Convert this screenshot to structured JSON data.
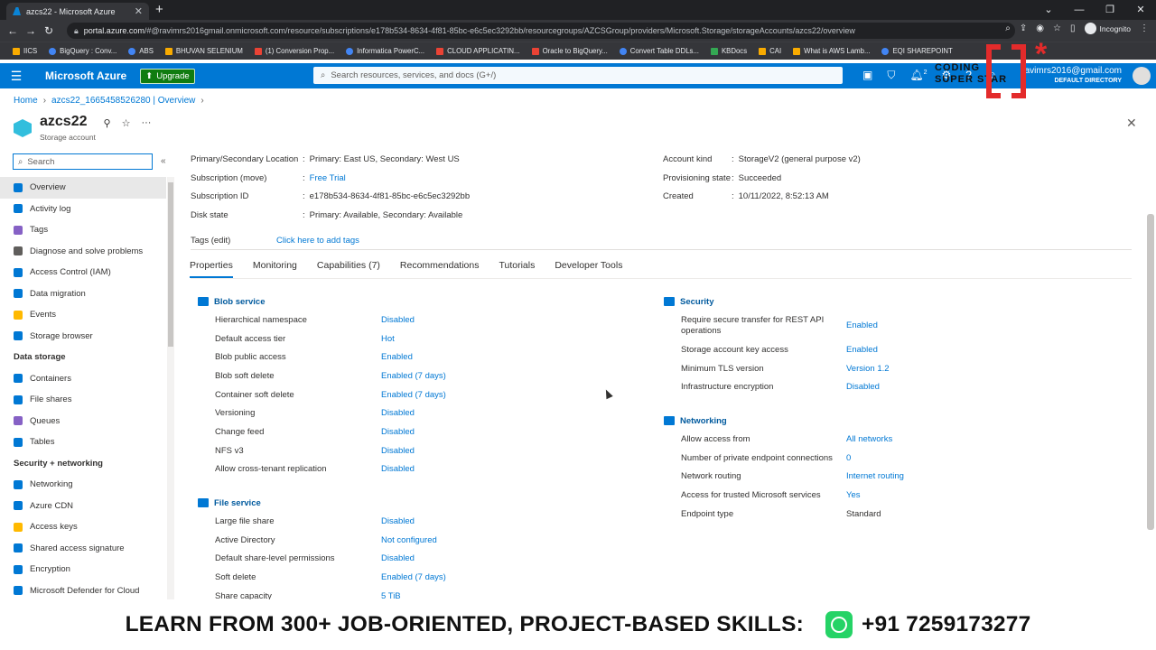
{
  "browser": {
    "tab_title": "azcs22 - Microsoft Azure",
    "url_host": "portal.azure.com",
    "url_rest": "/#@ravimrs2016gmail.onmicrosoft.com/resource/subscriptions/e178b534-8634-4f81-85bc-e6c5ec3292bb/resourcegroups/AZCSGroup/providers/Microsoft.Storage/storageAccounts/azcs22/overview",
    "incognito_label": "Incognito",
    "bookmarks": [
      "IICS",
      "BigQuery : Conv...",
      "ABS",
      "BHUVAN SELENIUM",
      "(1) Conversion Prop...",
      "Informatica PowerC...",
      "CLOUD APPLICATIN...",
      "Oracle to BigQuery...",
      "Convert Table DDLs...",
      "KBDocs",
      "CAI",
      "What is AWS Lamb...",
      "EQI SHAREPOINT"
    ]
  },
  "portal": {
    "brand": "Microsoft Azure",
    "upgrade_label": "Upgrade",
    "search_placeholder": "Search resources, services, and docs (G+/)",
    "notification_count": "2",
    "user_email": "ravimrs2016@gmail.com",
    "user_directory": "DEFAULT DIRECTORY"
  },
  "watermark": {
    "line1": "CODING",
    "line2": "SUPER STAR"
  },
  "breadcrumb": {
    "home": "Home",
    "item": "azcs22_1665458526280 | Overview"
  },
  "resource": {
    "name": "azcs22",
    "type": "Storage account"
  },
  "sidebar": {
    "search_placeholder": "Search",
    "items": [
      {
        "label": "Overview",
        "color": "#0078d4"
      },
      {
        "label": "Activity log",
        "color": "#0078d4"
      },
      {
        "label": "Tags",
        "color": "#8661c5"
      },
      {
        "label": "Diagnose and solve problems",
        "color": "#605e5c"
      },
      {
        "label": "Access Control (IAM)",
        "color": "#0078d4"
      },
      {
        "label": "Data migration",
        "color": "#0078d4"
      },
      {
        "label": "Events",
        "color": "#ffb900"
      },
      {
        "label": "Storage browser",
        "color": "#0078d4"
      }
    ],
    "data_storage_heading": "Data storage",
    "data_storage_items": [
      {
        "label": "Containers",
        "color": "#0078d4"
      },
      {
        "label": "File shares",
        "color": "#0078d4"
      },
      {
        "label": "Queues",
        "color": "#8661c5"
      },
      {
        "label": "Tables",
        "color": "#0078d4"
      }
    ],
    "security_heading": "Security + networking",
    "security_items": [
      {
        "label": "Networking",
        "color": "#0078d4"
      },
      {
        "label": "Azure CDN",
        "color": "#0078d4"
      },
      {
        "label": "Access keys",
        "color": "#ffb900"
      },
      {
        "label": "Shared access signature",
        "color": "#0078d4"
      },
      {
        "label": "Encryption",
        "color": "#0078d4"
      },
      {
        "label": "Microsoft Defender for Cloud",
        "color": "#0078d4"
      }
    ]
  },
  "essentials": {
    "left": [
      {
        "label": "Primary/Secondary Location",
        "value": "Primary: East US, Secondary: West US"
      },
      {
        "label": "Subscription (move)",
        "value": "Free Trial"
      },
      {
        "label": "Subscription ID",
        "value": "e178b534-8634-4f81-85bc-e6c5ec3292bb"
      },
      {
        "label": "Disk state",
        "value": "Primary: Available, Secondary: Available"
      }
    ],
    "right": [
      {
        "label": "Account kind",
        "value": "StorageV2 (general purpose v2)"
      },
      {
        "label": "Provisioning state",
        "value": "Succeeded"
      },
      {
        "label": "Created",
        "value": "10/11/2022, 8:52:13 AM"
      }
    ],
    "tags_label": "Tags (edit)",
    "tags_value": "Click here to add tags"
  },
  "tabs": [
    "Properties",
    "Monitoring",
    "Capabilities (7)",
    "Recommendations",
    "Tutorials",
    "Developer Tools"
  ],
  "blob_service": {
    "title": "Blob service",
    "props": [
      {
        "k": "Hierarchical namespace",
        "v": "Disabled"
      },
      {
        "k": "Default access tier",
        "v": "Hot"
      },
      {
        "k": "Blob public access",
        "v": "Enabled"
      },
      {
        "k": "Blob soft delete",
        "v": "Enabled (7 days)"
      },
      {
        "k": "Container soft delete",
        "v": "Enabled (7 days)"
      },
      {
        "k": "Versioning",
        "v": "Disabled"
      },
      {
        "k": "Change feed",
        "v": "Disabled"
      },
      {
        "k": "NFS v3",
        "v": "Disabled"
      },
      {
        "k": "Allow cross-tenant replication",
        "v": "Disabled"
      }
    ]
  },
  "file_service": {
    "title": "File service",
    "props": [
      {
        "k": "Large file share",
        "v": "Disabled"
      },
      {
        "k": "Active Directory",
        "v": "Not configured"
      },
      {
        "k": "Default share-level permissions",
        "v": "Disabled"
      },
      {
        "k": "Soft delete",
        "v": "Enabled (7 days)"
      },
      {
        "k": "Share capacity",
        "v": "5 TiB"
      }
    ]
  },
  "security": {
    "title": "Security",
    "props": [
      {
        "k": "Require secure transfer for REST API operations",
        "v": "Enabled"
      },
      {
        "k": "Storage account key access",
        "v": "Enabled"
      },
      {
        "k": "Minimum TLS version",
        "v": "Version 1.2"
      },
      {
        "k": "Infrastructure encryption",
        "v": "Disabled"
      }
    ]
  },
  "networking": {
    "title": "Networking",
    "props": [
      {
        "k": "Allow access from",
        "v": "All networks"
      },
      {
        "k": "Number of private endpoint connections",
        "v": "0"
      },
      {
        "k": "Network routing",
        "v": "Internet routing"
      },
      {
        "k": "Access for trusted Microsoft services",
        "v": "Yes"
      },
      {
        "k": "Endpoint type",
        "v": "Standard"
      }
    ]
  },
  "banner": {
    "text": "LEARN FROM 300+ JOB-ORIENTED, PROJECT-BASED SKILLS:",
    "phone": "+91 7259173277"
  }
}
